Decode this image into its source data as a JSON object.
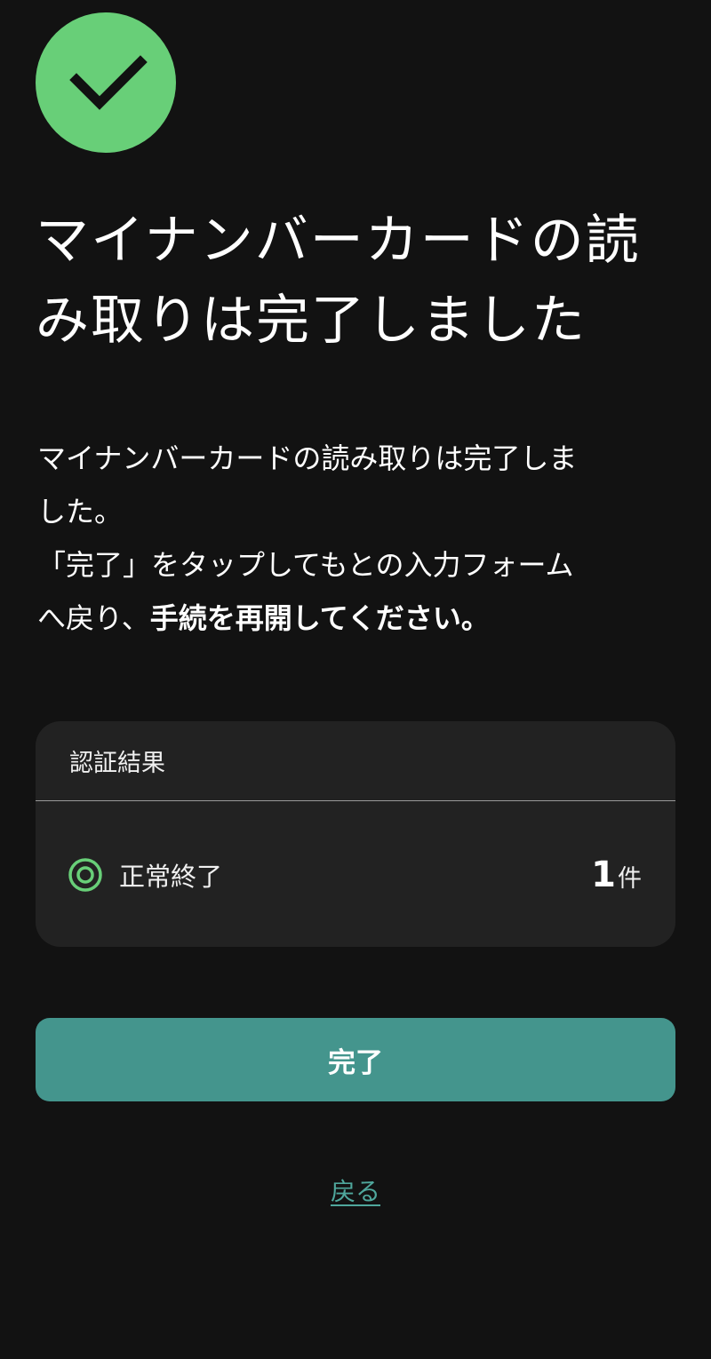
{
  "colors": {
    "background": "#121212",
    "success": "#68cf78",
    "card": "#222222",
    "primary_button": "#44958d",
    "link": "#4fa79c"
  },
  "header": {
    "icon": "checkmark-icon",
    "title_line1": "マイナンバーカードの読",
    "title_line2": "み取りは完了しました"
  },
  "description": {
    "line1": "マイナンバーカードの読み取りは完了しま",
    "line2": "した。",
    "line3": "「完了」をタップしてもとの入力フォーム",
    "line4_prefix": "へ戻り、",
    "line4_bold": "手続を再開してください。"
  },
  "result_card": {
    "header": "認証結果",
    "rows": [
      {
        "icon": "double-circle-icon",
        "label": "正常終了",
        "count": "1",
        "unit": "件"
      }
    ]
  },
  "actions": {
    "done_label": "完了",
    "back_label": "戻る"
  }
}
